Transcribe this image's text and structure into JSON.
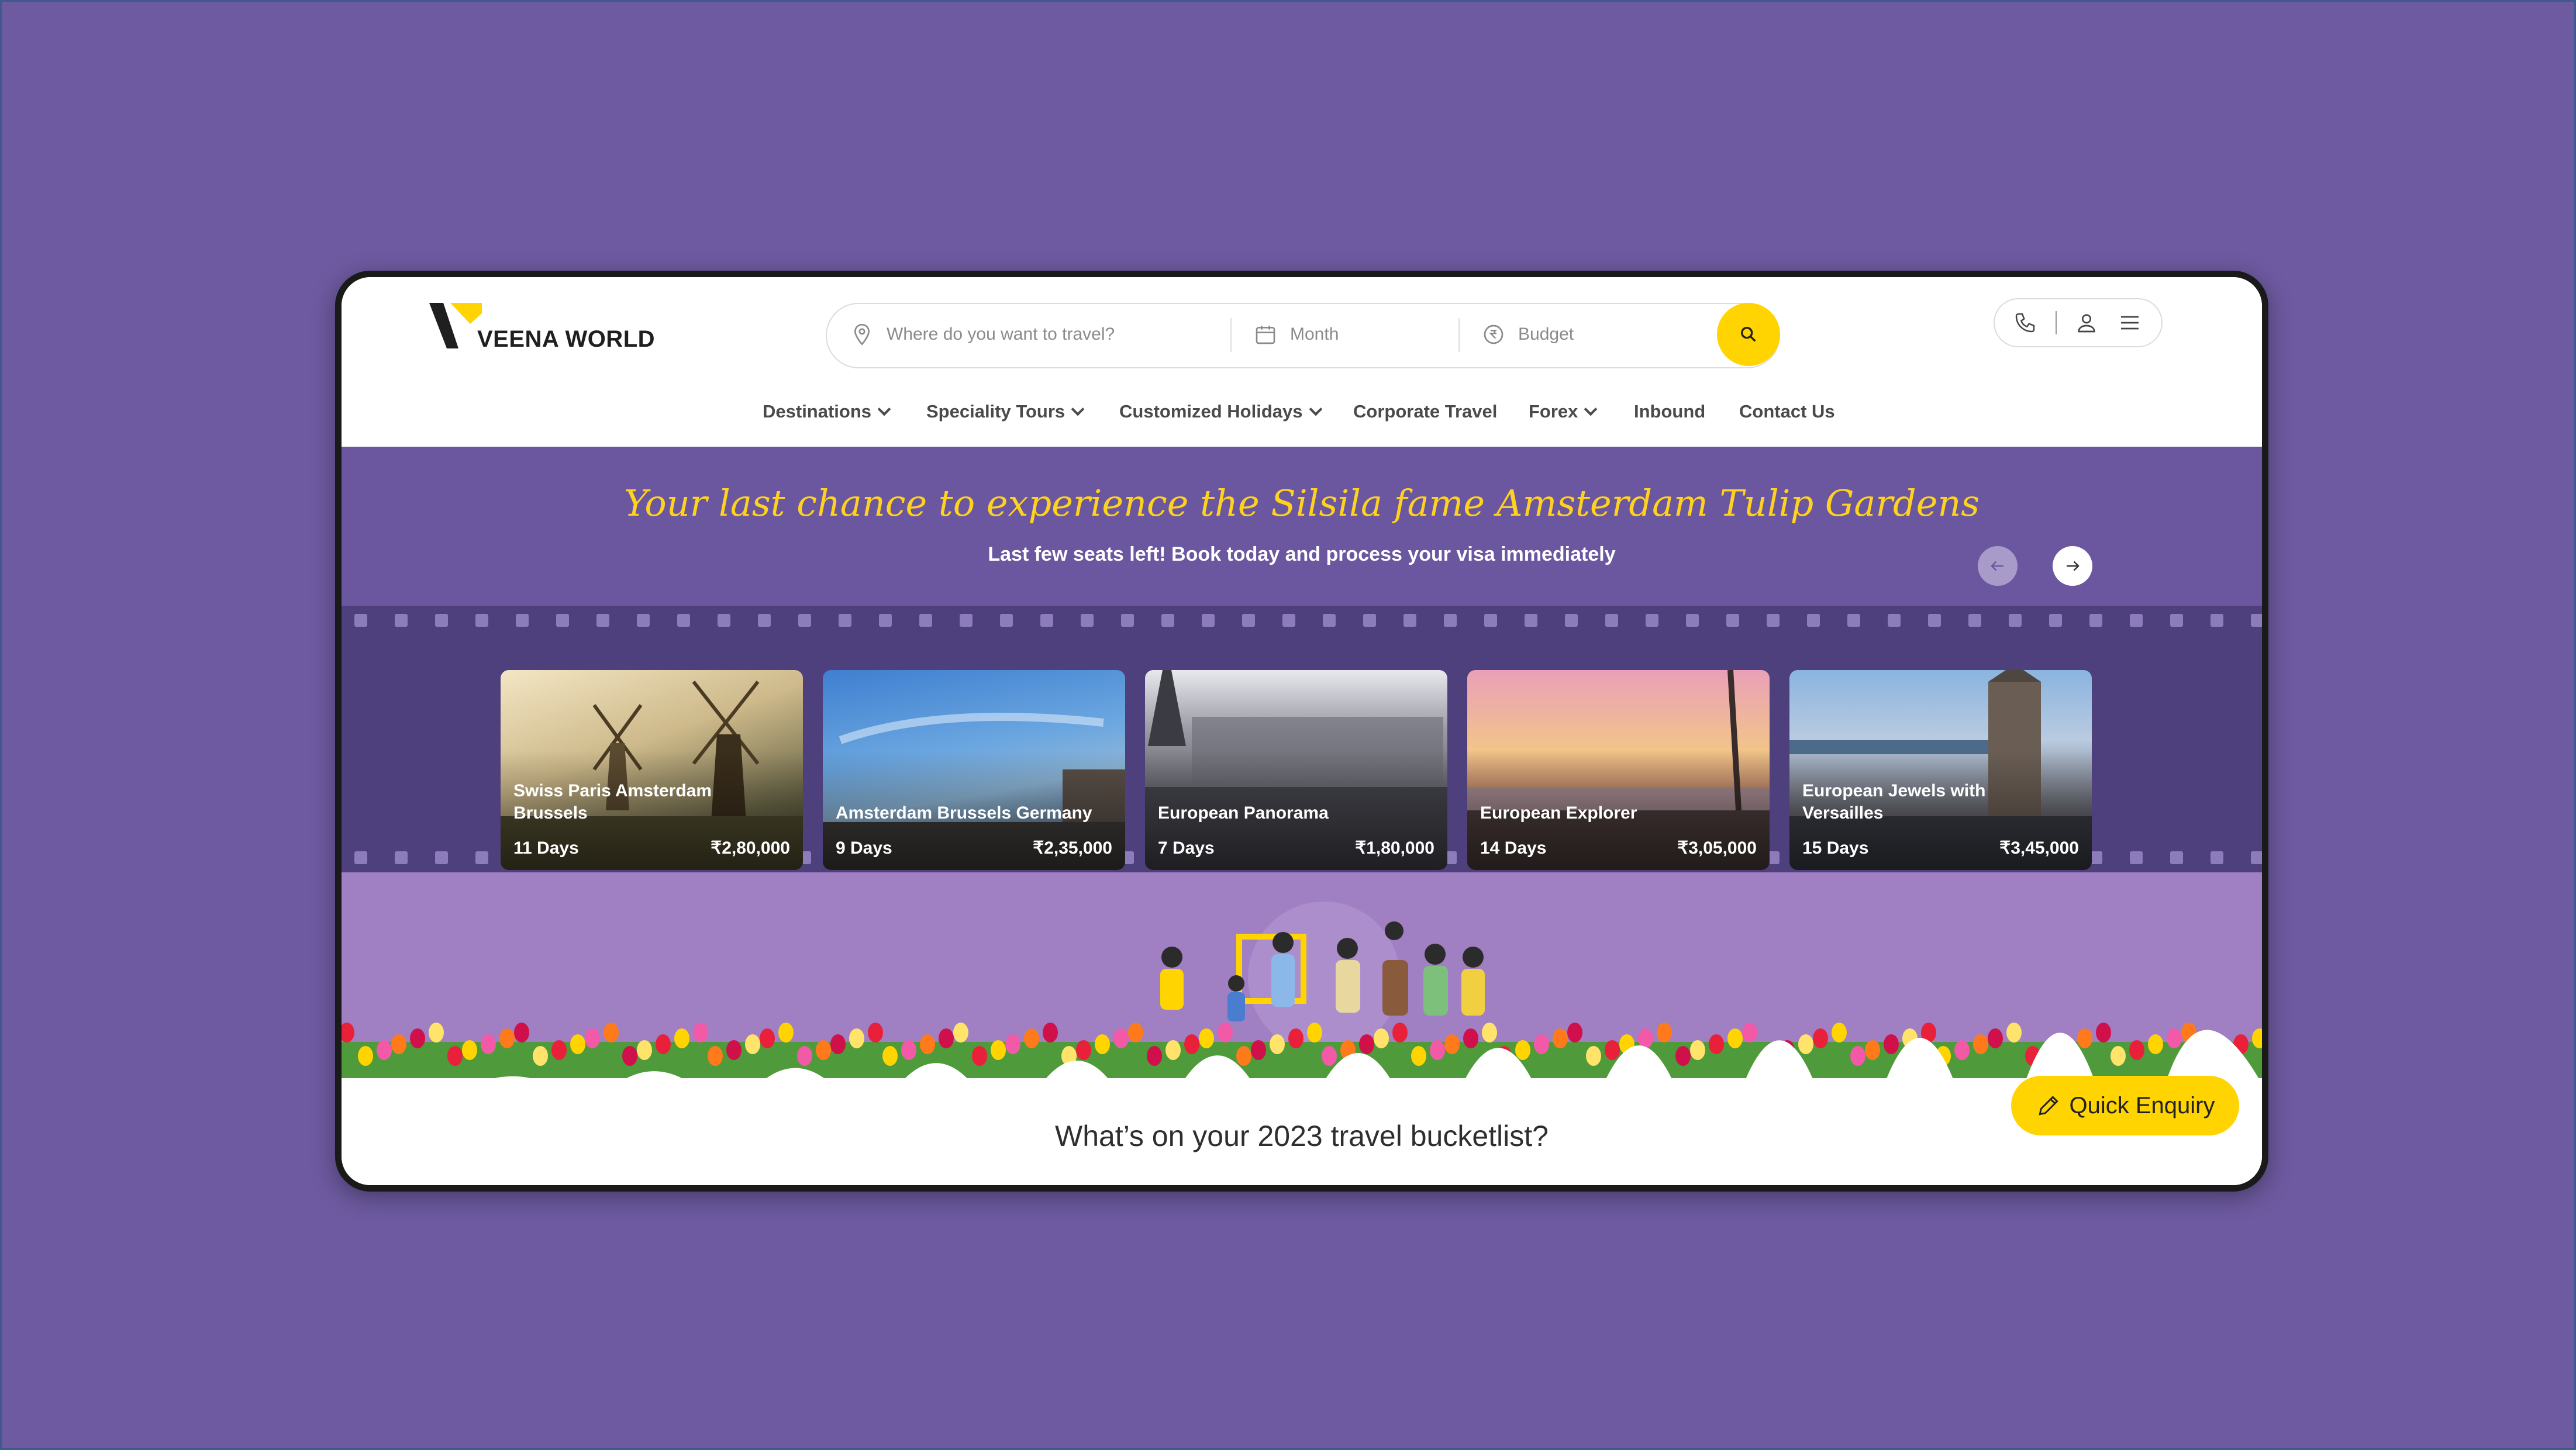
{
  "brand": {
    "name": "VEENA WORLD",
    "accent": "#ffd400",
    "banner_color": "#6b579f"
  },
  "search": {
    "where_placeholder": "Where do you want to travel?",
    "month_placeholder": "Month",
    "budget_placeholder": "Budget"
  },
  "nav": {
    "items": [
      {
        "label": "Destinations",
        "dropdown": true
      },
      {
        "label": "Speciality Tours",
        "dropdown": true
      },
      {
        "label": "Customized Holidays",
        "dropdown": true
      },
      {
        "label": "Corporate Travel",
        "dropdown": false
      },
      {
        "label": "Forex",
        "dropdown": true
      },
      {
        "label": "Inbound",
        "dropdown": false
      },
      {
        "label": "Contact Us",
        "dropdown": false
      }
    ]
  },
  "banner": {
    "headline": "Your last chance to experience the Silsila fame Amsterdam Tulip Gardens",
    "subline": "Last few seats left! Book today and process your visa immediately"
  },
  "tours": [
    {
      "title": "Swiss Paris Amsterdam Brussels",
      "days": "11 Days",
      "price": "₹2,80,000"
    },
    {
      "title": "Amsterdam Brussels Germany",
      "days": "9 Days",
      "price": "₹2,35,000"
    },
    {
      "title": "European Panorama",
      "days": "7 Days",
      "price": "₹1,80,000"
    },
    {
      "title": "European Explorer",
      "days": "14 Days",
      "price": "₹3,05,000"
    },
    {
      "title": "European Jewels with Versailles",
      "days": "15 Days",
      "price": "₹3,45,000"
    }
  ],
  "bucketlist_title": "What’s on your 2023 travel bucketlist?",
  "quick_enquiry": "Quick Enquiry",
  "icons": [
    "location-pin-icon",
    "calendar-icon",
    "rupee-icon",
    "search-icon",
    "phone-icon",
    "user-icon",
    "menu-icon",
    "arrow-left-icon",
    "arrow-right-icon",
    "pencil-icon"
  ]
}
